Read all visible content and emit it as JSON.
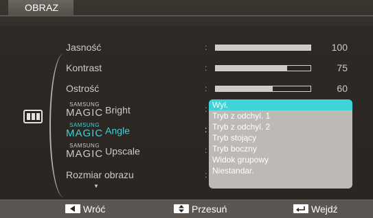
{
  "window": {
    "title": "OBRAZ"
  },
  "menu": {
    "items": [
      {
        "label": "Jasność",
        "value": "100",
        "level": 1.0
      },
      {
        "label": "Kontrast",
        "value": "75",
        "level": 0.75
      },
      {
        "label": "Ostrość",
        "value": "60",
        "level": 0.6
      },
      {
        "brand_top": "SAMSUNG",
        "brand_bottom": "MAGIC",
        "label": "Bright"
      },
      {
        "brand_top": "SAMSUNG",
        "brand_bottom": "MAGIC",
        "label": "Angle"
      },
      {
        "brand_top": "SAMSUNG",
        "brand_bottom": "MAGIC",
        "label": "Upscale"
      },
      {
        "label": "Rozmiar obrazu"
      }
    ],
    "active_item": "Angle"
  },
  "dropdown": {
    "options": [
      "Wył.",
      "Tryb z odchyl. 1",
      "Tryb z odchyl. 2",
      "Tryb stojący",
      "Tryb boczny",
      "Widok grupowy",
      "Niestandar."
    ],
    "selected": "Wył."
  },
  "footer": {
    "back_label": "Wróć",
    "move_label": "Przesuń",
    "enter_label": "Wejdź"
  },
  "colors": {
    "accent": "#3ed3d6",
    "background": "#2b2622",
    "footer": "#5b5651",
    "dropdown": "#bdb9b4"
  },
  "icons": {
    "category": "picture-monitor-icon",
    "back": "back-arrow-key-icon",
    "move": "updown-arrow-key-icon",
    "enter": "enter-key-icon",
    "more": "scroll-down-arrow-icon"
  }
}
